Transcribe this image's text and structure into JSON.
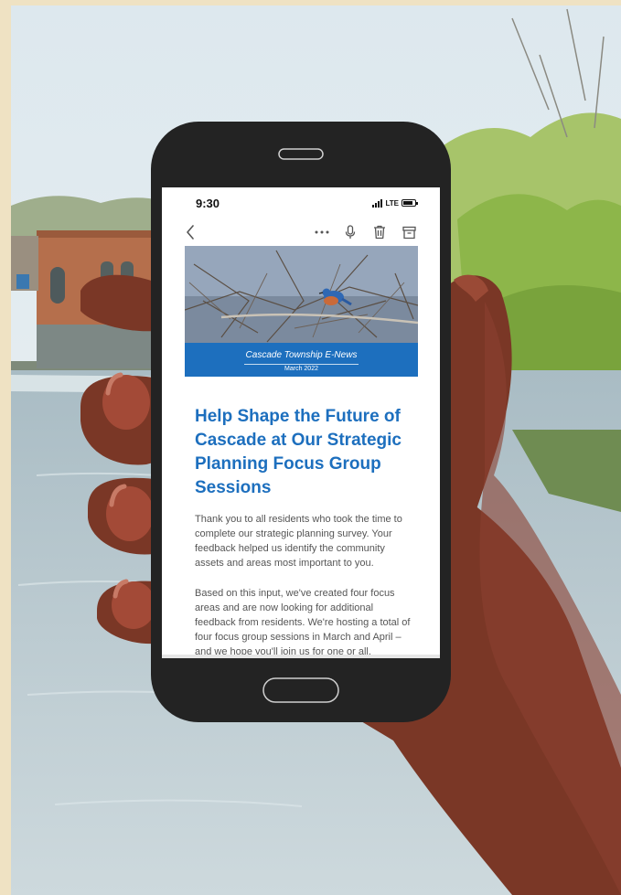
{
  "status_bar": {
    "time": "9:30",
    "network": "LTE"
  },
  "toolbar": {
    "icons": [
      "chevron-left-icon",
      "more-dots-icon",
      "microphone-icon",
      "trash-icon",
      "archive-icon"
    ]
  },
  "newsletter": {
    "banner_title": "Cascade Township E-News",
    "banner_date": "March 2022",
    "headline": "Help Shape the Future of Cascade at Our Strategic Planning Focus Group Sessions",
    "paragraphs": [
      "Thank you to all residents who took the time to complete our strategic planning survey. Your feedback helped us identify the community assets and areas most important to you.",
      "Based on this input, we've created four focus areas and are now looking for additional feedback from residents. We're hosting a total of four focus group sessions in March and April – and we hope you'll join us for one or all."
    ]
  },
  "colors": {
    "accent_blue": "#1d6fbe",
    "body_text": "#555555",
    "skin_tone": "#7a3726",
    "phone_body": "#232323",
    "frame_beige": "#efe2c3"
  }
}
